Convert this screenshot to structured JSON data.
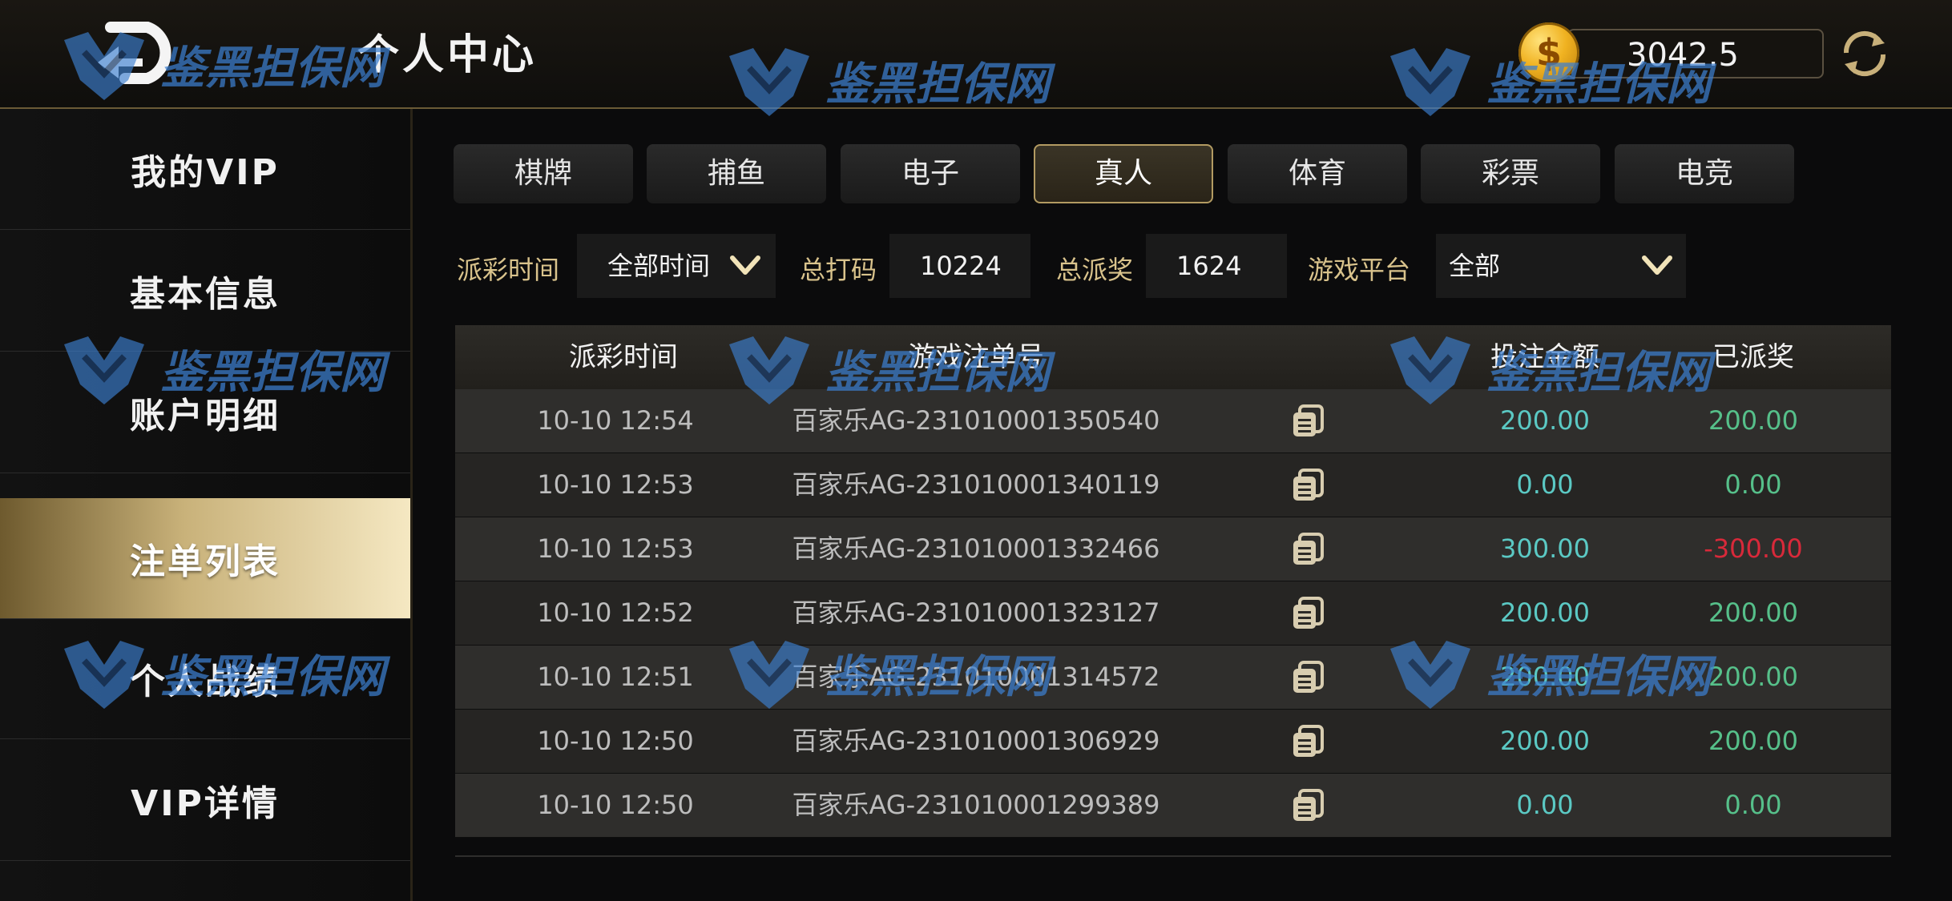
{
  "header": {
    "title": "个人中心",
    "balance": "3042.5",
    "coin_symbol": "$"
  },
  "sidebar": {
    "items": [
      {
        "label": "我的VIP"
      },
      {
        "label": "基本信息"
      },
      {
        "label": "账户明细"
      },
      {
        "label": "注单列表",
        "active": true
      },
      {
        "label": "个人战绩"
      },
      {
        "label": "VIP详情"
      }
    ]
  },
  "tabs": [
    {
      "label": "棋牌"
    },
    {
      "label": "捕鱼"
    },
    {
      "label": "电子"
    },
    {
      "label": "真人",
      "active": true
    },
    {
      "label": "体育"
    },
    {
      "label": "彩票"
    },
    {
      "label": "电竞"
    }
  ],
  "filters": {
    "time_label": "派彩时间",
    "time_value": "全部时间",
    "bet_total_label": "总打码",
    "bet_total_value": "10224",
    "payout_total_label": "总派奖",
    "payout_total_value": "1624",
    "platform_label": "游戏平台",
    "platform_value": "全部"
  },
  "table": {
    "columns": [
      "派彩时间",
      "游戏注单号",
      "投注金额",
      "已派奖"
    ],
    "rows": [
      {
        "time": "10-10 12:54",
        "order": "百家乐AG-231010001350540",
        "bet": "200.00",
        "payout": "200.00",
        "payout_status": "win"
      },
      {
        "time": "10-10 12:53",
        "order": "百家乐AG-231010001340119",
        "bet": "0.00",
        "payout": "0.00",
        "payout_status": "win"
      },
      {
        "time": "10-10 12:53",
        "order": "百家乐AG-231010001332466",
        "bet": "300.00",
        "payout": "-300.00",
        "payout_status": "loss"
      },
      {
        "time": "10-10 12:52",
        "order": "百家乐AG-231010001323127",
        "bet": "200.00",
        "payout": "200.00",
        "payout_status": "win"
      },
      {
        "time": "10-10 12:51",
        "order": "百家乐AG-231010001314572",
        "bet": "200.00",
        "payout": "200.00",
        "payout_status": "win"
      },
      {
        "time": "10-10 12:50",
        "order": "百家乐AG-231010001306929",
        "bet": "200.00",
        "payout": "200.00",
        "payout_status": "win"
      },
      {
        "time": "10-10 12:50",
        "order": "百家乐AG-231010001299389",
        "bet": "0.00",
        "payout": "0.00",
        "payout_status": "win"
      }
    ]
  },
  "watermark": {
    "text": "鉴黑担保网"
  },
  "colors": {
    "accent_gold": "#d9c38c",
    "bet_amount": "#5bc9c4",
    "payout_positive": "#56c08a",
    "payout_negative": "#d8293a",
    "watermark_blue": "#3c7fd0"
  },
  "icons": {
    "back": "back-arrow-icon",
    "coin": "coin-icon",
    "refresh": "refresh-icon",
    "dropdown": "chevron-down-icon",
    "copy": "copy-icon"
  }
}
